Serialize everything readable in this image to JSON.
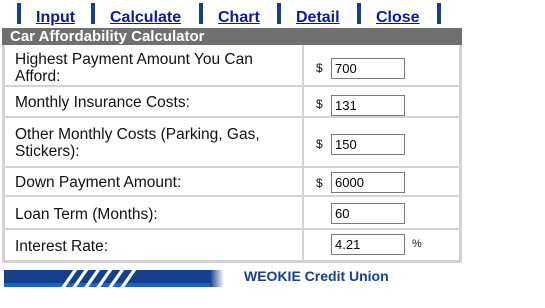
{
  "nav": {
    "items": [
      {
        "label": "Input"
      },
      {
        "label": "Calculate"
      },
      {
        "label": "Chart"
      },
      {
        "label": "Detail"
      },
      {
        "label": "Close"
      }
    ]
  },
  "calculator": {
    "title": "Car Affordability Calculator",
    "rows": [
      {
        "label": "Highest Payment Amount You Can Afford:",
        "currency": "$",
        "value": "700",
        "unit": ""
      },
      {
        "label": "Monthly Insurance Costs:",
        "currency": "$",
        "value": "131",
        "unit": ""
      },
      {
        "label": "Other Monthly Costs (Parking, Gas, Stickers):",
        "currency": "$",
        "value": "150",
        "unit": ""
      },
      {
        "label": "Down Payment Amount:",
        "currency": "$",
        "value": "6000",
        "unit": ""
      },
      {
        "label": "Loan Term (Months):",
        "currency": "",
        "value": "60",
        "unit": ""
      },
      {
        "label": "Interest Rate:",
        "currency": "",
        "value": "4.21",
        "unit": "%"
      }
    ]
  },
  "footer": {
    "brand": "WEOKIE Credit Union"
  },
  "colors": {
    "nav_link": "#0a1aa0",
    "nav_separator": "#12408c",
    "title_bar": "#707070",
    "brand": "#12408c",
    "row_border": "#d3d3d3"
  }
}
